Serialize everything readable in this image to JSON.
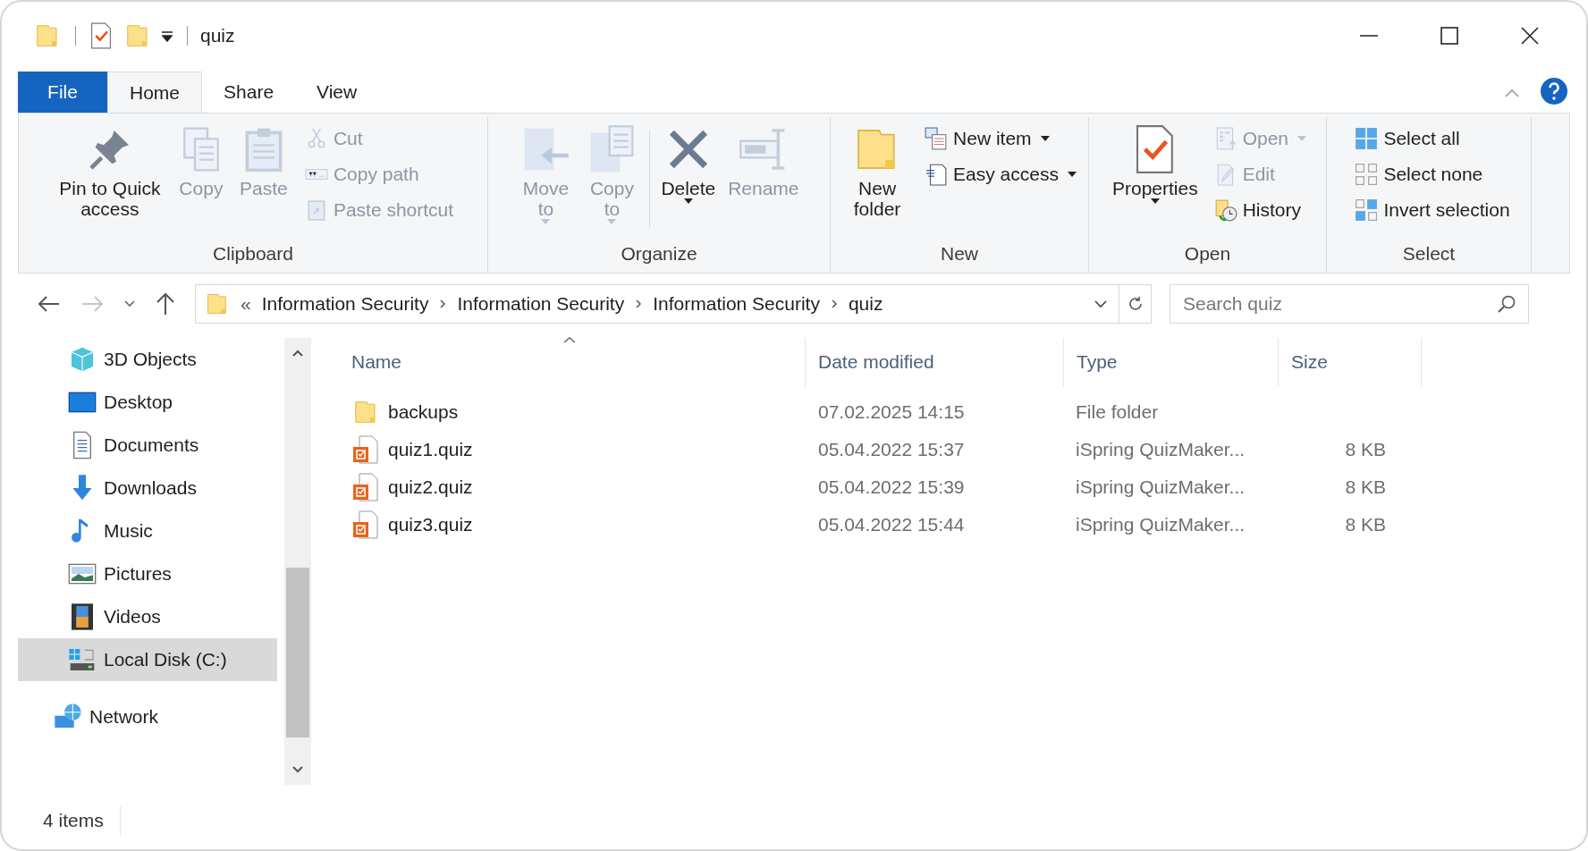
{
  "window": {
    "title": "quiz"
  },
  "tabs": [
    {
      "label": "File",
      "kind": "file",
      "selected": false
    },
    {
      "label": "Home",
      "kind": "tab",
      "selected": true
    },
    {
      "label": "Share",
      "kind": "tab",
      "selected": false
    },
    {
      "label": "View",
      "kind": "tab",
      "selected": false
    }
  ],
  "ribbon": {
    "groups": [
      {
        "label": "Clipboard",
        "commands": [
          {
            "kind": "large",
            "label": "Pin to Quick access",
            "disabled": false,
            "dropdown": false
          },
          {
            "kind": "large",
            "label": "Copy",
            "disabled": true,
            "dropdown": false
          },
          {
            "kind": "large",
            "label": "Paste",
            "disabled": true,
            "dropdown": false
          },
          {
            "kind": "small",
            "label": "Cut",
            "disabled": true,
            "dropdown": false
          },
          {
            "kind": "small",
            "label": "Copy path",
            "disabled": true,
            "dropdown": false
          },
          {
            "kind": "small",
            "label": "Paste shortcut",
            "disabled": true,
            "dropdown": false
          }
        ]
      },
      {
        "label": "Organize",
        "commands": [
          {
            "kind": "large",
            "label": "Move to",
            "disabled": true,
            "dropdown": true
          },
          {
            "kind": "large",
            "label": "Copy to",
            "disabled": true,
            "dropdown": true
          },
          {
            "kind": "large",
            "label": "Delete",
            "disabled": false,
            "dropdown": true
          },
          {
            "kind": "large",
            "label": "Rename",
            "disabled": true,
            "dropdown": false
          }
        ]
      },
      {
        "label": "New",
        "commands": [
          {
            "kind": "large",
            "label": "New folder",
            "disabled": false,
            "dropdown": false
          },
          {
            "kind": "small",
            "label": "New item",
            "disabled": false,
            "dropdown": true
          },
          {
            "kind": "small",
            "label": "Easy access",
            "disabled": false,
            "dropdown": true
          }
        ]
      },
      {
        "label": "Open",
        "commands": [
          {
            "kind": "large",
            "label": "Properties",
            "disabled": false,
            "dropdown": true
          },
          {
            "kind": "small",
            "label": "Open",
            "disabled": true,
            "dropdown": true
          },
          {
            "kind": "small",
            "label": "Edit",
            "disabled": true,
            "dropdown": false
          },
          {
            "kind": "small",
            "label": "History",
            "disabled": false,
            "dropdown": false
          }
        ]
      },
      {
        "label": "Select",
        "commands": [
          {
            "kind": "small",
            "label": "Select all",
            "disabled": false,
            "dropdown": false
          },
          {
            "kind": "small",
            "label": "Select none",
            "disabled": false,
            "dropdown": false
          },
          {
            "kind": "small",
            "label": "Invert selection",
            "disabled": false,
            "dropdown": false
          }
        ]
      }
    ]
  },
  "address_bar": {
    "overflow": "«",
    "breadcrumbs": [
      "Information Security",
      "Information Security",
      "Information Security",
      "quiz"
    ]
  },
  "search": {
    "placeholder": "Search quiz"
  },
  "nav_pane": {
    "tree": [
      {
        "children": [
          {
            "label": "3D Objects",
            "selected": false
          },
          {
            "label": "Desktop",
            "selected": false
          },
          {
            "label": "Documents",
            "selected": false
          },
          {
            "label": "Downloads",
            "selected": false
          },
          {
            "label": "Music",
            "selected": false
          },
          {
            "label": "Pictures",
            "selected": false
          },
          {
            "label": "Videos",
            "selected": false
          },
          {
            "label": "Local Disk (C:)",
            "selected": true
          }
        ]
      },
      {
        "label": "Network",
        "selected": false
      }
    ]
  },
  "file_list": {
    "columns": [
      {
        "label": "Name",
        "sorted": true
      },
      {
        "label": "Date modified",
        "sorted": false
      },
      {
        "label": "Type",
        "sorted": false
      },
      {
        "label": "Size",
        "sorted": false
      }
    ],
    "rows": [
      {
        "kind": "folder",
        "name": "backups",
        "date": "07.02.2025 14:15",
        "type": "File folder"
      },
      {
        "kind": "quiz",
        "name": "quiz1.quiz",
        "date": "05.04.2022 15:37",
        "type": "iSpring QuizMaker...",
        "size": "8 KB"
      },
      {
        "kind": "quiz",
        "name": "quiz2.quiz",
        "date": "05.04.2022 15:39",
        "type": "iSpring QuizMaker...",
        "size": "8 KB"
      },
      {
        "kind": "quiz",
        "name": "quiz3.quiz",
        "date": "05.04.2022 15:44",
        "type": "iSpring QuizMaker...",
        "size": "8 KB"
      }
    ]
  },
  "status_bar": {
    "item_count": "4 items"
  }
}
